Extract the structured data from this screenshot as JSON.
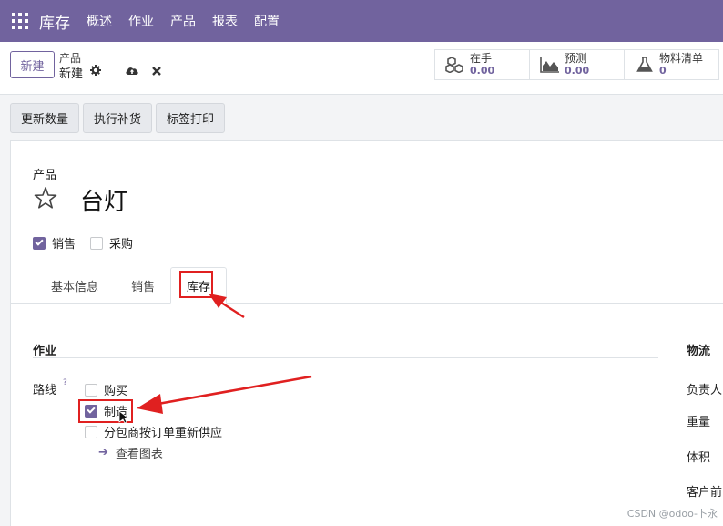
{
  "navbar": {
    "brand": "库存",
    "menu": [
      {
        "label": "概述"
      },
      {
        "label": "作业"
      },
      {
        "label": "产品"
      },
      {
        "label": "报表"
      },
      {
        "label": "配置"
      }
    ],
    "color": "#71639e"
  },
  "control": {
    "new_label": "新建",
    "breadcrumb_parent": "产品",
    "breadcrumb_current": "新建",
    "icons": [
      "gear-icon",
      "cloud-upload-icon",
      "discard-icon"
    ],
    "stats": [
      {
        "label": "在手",
        "value": "0.00",
        "icon": "cubes-icon"
      },
      {
        "label": "预测",
        "value": "0.00",
        "icon": "area-chart-icon"
      },
      {
        "label": "物料清单",
        "value": "0",
        "icon": "flask-icon"
      }
    ]
  },
  "actions": [
    {
      "label": "更新数量"
    },
    {
      "label": "执行补货"
    },
    {
      "label": "标签打印"
    }
  ],
  "form": {
    "product_label": "产品",
    "product_name": "台灯",
    "options": [
      {
        "label": "销售",
        "checked": true
      },
      {
        "label": "采购",
        "checked": false
      }
    ],
    "tabs": [
      {
        "label": "基本信息",
        "active": false
      },
      {
        "label": "销售",
        "active": false
      },
      {
        "label": "库存",
        "active": true
      }
    ],
    "operations": {
      "title": "作业",
      "routes_label": "路线",
      "help": "?",
      "routes": [
        {
          "label": "购买",
          "checked": false
        },
        {
          "label": "制造",
          "checked": true
        },
        {
          "label": "分包商按订单重新供应",
          "checked": false
        }
      ],
      "view_diagram": "查看图表"
    },
    "logistics": {
      "title": "物流",
      "fields": [
        "负责人",
        "重量",
        "体积",
        "客户前"
      ]
    }
  },
  "watermark": "CSDN @odoo-卜永",
  "colors": {
    "accent": "#71639e",
    "annotation": "#e02020"
  }
}
